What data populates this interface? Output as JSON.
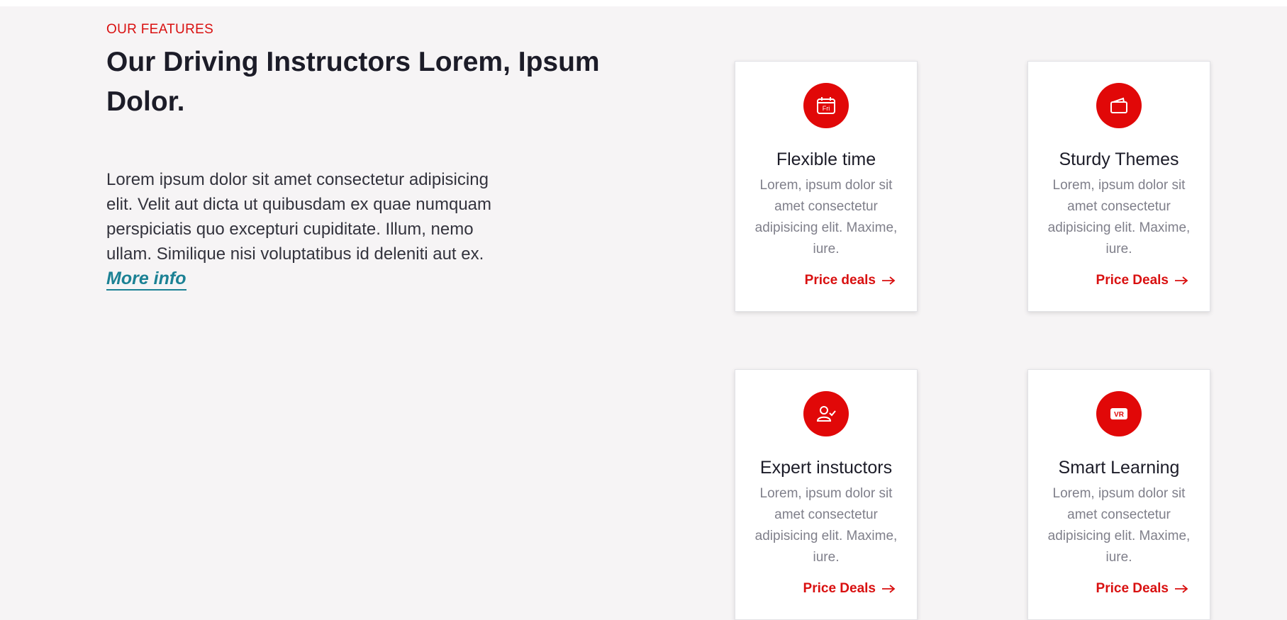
{
  "features": {
    "eyebrow": "OUR FEATURES",
    "headline": "Our Driving Instructors Lorem, Ipsum Dolor.",
    "body": "Lorem ipsum dolor sit amet consectetur adipisicing elit. Velit aut dicta ut quibusdam ex quae numquam perspiciatis quo excepturi cupiditate. Illum, nemo ullam. Similique nisi voluptatibus id deleniti aut ex.",
    "more_info": "More info"
  },
  "cards": [
    {
      "icon": "calendar-icon",
      "icon_text": "Fri",
      "title": "Flexible time",
      "desc": "Lorem, ipsum dolor sit amet consectetur adipisicing elit. Maxime, iure.",
      "link": "Price deals"
    },
    {
      "icon": "wallet-icon",
      "icon_text": "",
      "title": "Sturdy Themes",
      "desc": "Lorem, ipsum dolor sit amet consectetur adipisicing elit. Maxime, iure.",
      "link": "Price Deals"
    },
    {
      "icon": "person-check-icon",
      "icon_text": "",
      "title": "Expert instuctors",
      "desc": "Lorem, ipsum dolor sit amet consectetur adipisicing elit. Maxime, iure.",
      "link": "Price Deals"
    },
    {
      "icon": "vr-icon",
      "icon_text": "VR",
      "title": "Smart Learning",
      "desc": "Lorem, ipsum dolor sit amet consectetur adipisicing elit. Maxime, iure.",
      "link": "Price Deals"
    }
  ],
  "colors": {
    "accent": "#e10808",
    "link_teal": "#1b8194",
    "background": "#f6f4f5"
  }
}
